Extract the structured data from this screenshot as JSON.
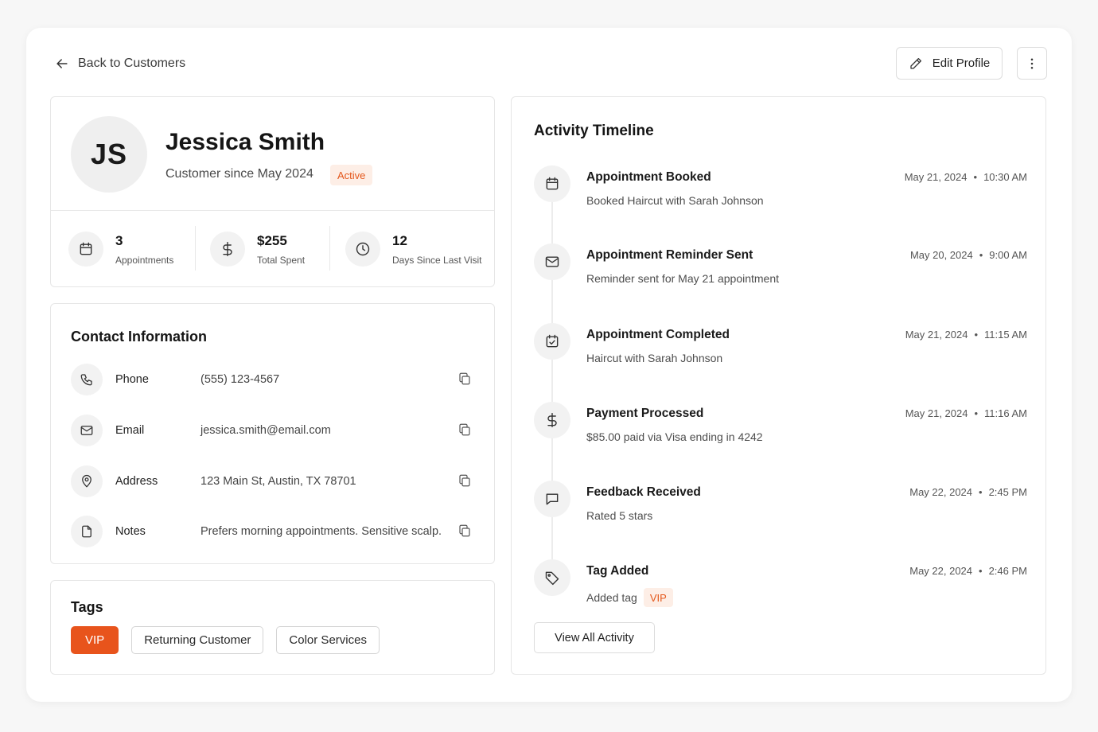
{
  "nav": {
    "back_label": "Back to Customers"
  },
  "actions": {
    "edit_label": "Edit Profile"
  },
  "profile": {
    "initials": "JS",
    "name": "Jessica Smith",
    "since": "Customer since May 2024",
    "status": "Active",
    "stats": [
      {
        "icon": "calendar-icon",
        "value": "3",
        "label": "Appointments"
      },
      {
        "icon": "dollar-icon",
        "value": "$255",
        "label": "Total Spent"
      },
      {
        "icon": "clock-icon",
        "value": "12",
        "label": "Days Since Last Visit"
      }
    ]
  },
  "contact": {
    "title": "Contact Information",
    "rows": [
      {
        "icon": "phone-icon",
        "label": "Phone",
        "value": "(555) 123-4567"
      },
      {
        "icon": "mail-icon",
        "label": "Email",
        "value": "jessica.smith@email.com"
      },
      {
        "icon": "map-pin-icon",
        "label": "Address",
        "value": "123 Main St, Austin, TX 78701"
      },
      {
        "icon": "file-icon",
        "label": "Notes",
        "value": "Prefers morning appointments. Sensitive scalp."
      }
    ]
  },
  "tags": {
    "title": "Tags",
    "items": [
      "VIP",
      "Returning Customer",
      "Color Services"
    ]
  },
  "timeline": {
    "title": "Activity Timeline",
    "items": [
      {
        "icon": "calendar-icon",
        "title": "Appointment Booked",
        "desc": "Booked Haircut with Sarah Johnson",
        "date": "May 21, 2024",
        "time": "10:30 AM"
      },
      {
        "icon": "mail-icon",
        "title": "Appointment Reminder Sent",
        "desc": "Reminder sent for May 21 appointment",
        "date": "May 20, 2024",
        "time": "9:00 AM"
      },
      {
        "icon": "calendar-check-icon",
        "title": "Appointment Completed",
        "desc": "Haircut with Sarah Johnson",
        "date": "May 21, 2024",
        "time": "11:15 AM"
      },
      {
        "icon": "dollar-icon",
        "title": "Payment Processed",
        "desc": "$85.00 paid via Visa ending in 4242",
        "date": "May 21, 2024",
        "time": "11:16 AM"
      },
      {
        "icon": "message-icon",
        "title": "Feedback Received",
        "desc": "Rated 5 stars",
        "date": "May 22, 2024",
        "time": "2:45 PM"
      },
      {
        "icon": "tag-icon",
        "title": "Tag Added",
        "desc": "Added tag",
        "tag": "VIP",
        "date": "May 22, 2024",
        "time": "2:46 PM"
      }
    ],
    "view_all_label": "View All Activity"
  },
  "colors": {
    "accent": "#e8541c",
    "accent_soft": "#fdeee6"
  },
  "separator": "•"
}
